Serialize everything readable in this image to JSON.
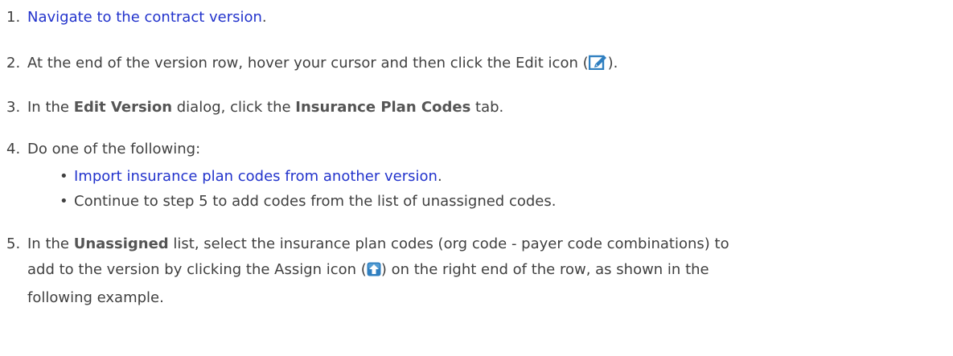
{
  "steps": [
    {
      "num": "1.",
      "link": "Navigate to the contract version",
      "after": "."
    },
    {
      "num": "2.",
      "before": "At the end of the version row, hover your cursor and then click the Edit icon (",
      "icon": "edit-icon",
      "after": ")."
    },
    {
      "num": "3.",
      "before": "In the ",
      "bold1": "Edit Version",
      "mid": " dialog, click the ",
      "bold2": "Insurance Plan Codes",
      "after": " tab."
    },
    {
      "num": "4.",
      "text": "Do one of the following:",
      "bullets": [
        {
          "dot": "•",
          "link": "Import insurance plan codes from another version",
          "after": "."
        },
        {
          "dot": "•",
          "text": "Continue to step 5 to add codes from the list of unassigned codes."
        }
      ]
    },
    {
      "num": "5.",
      "before": "In the ",
      "bold": "Unassigned",
      "line1_after": " list, select the insurance plan codes (org code - payer code combinations) to",
      "line2_before": "add to the version by clicking the Assign icon (",
      "icon": "assign-icon",
      "line2_after": ") on the right end of the row, as shown in the",
      "line3": "following example."
    }
  ],
  "colors": {
    "text": "#404040",
    "link": "#2233cc",
    "bold": "#555555",
    "edit_icon": "#2f7fc0",
    "assign_icon": "#2f7fc0"
  }
}
